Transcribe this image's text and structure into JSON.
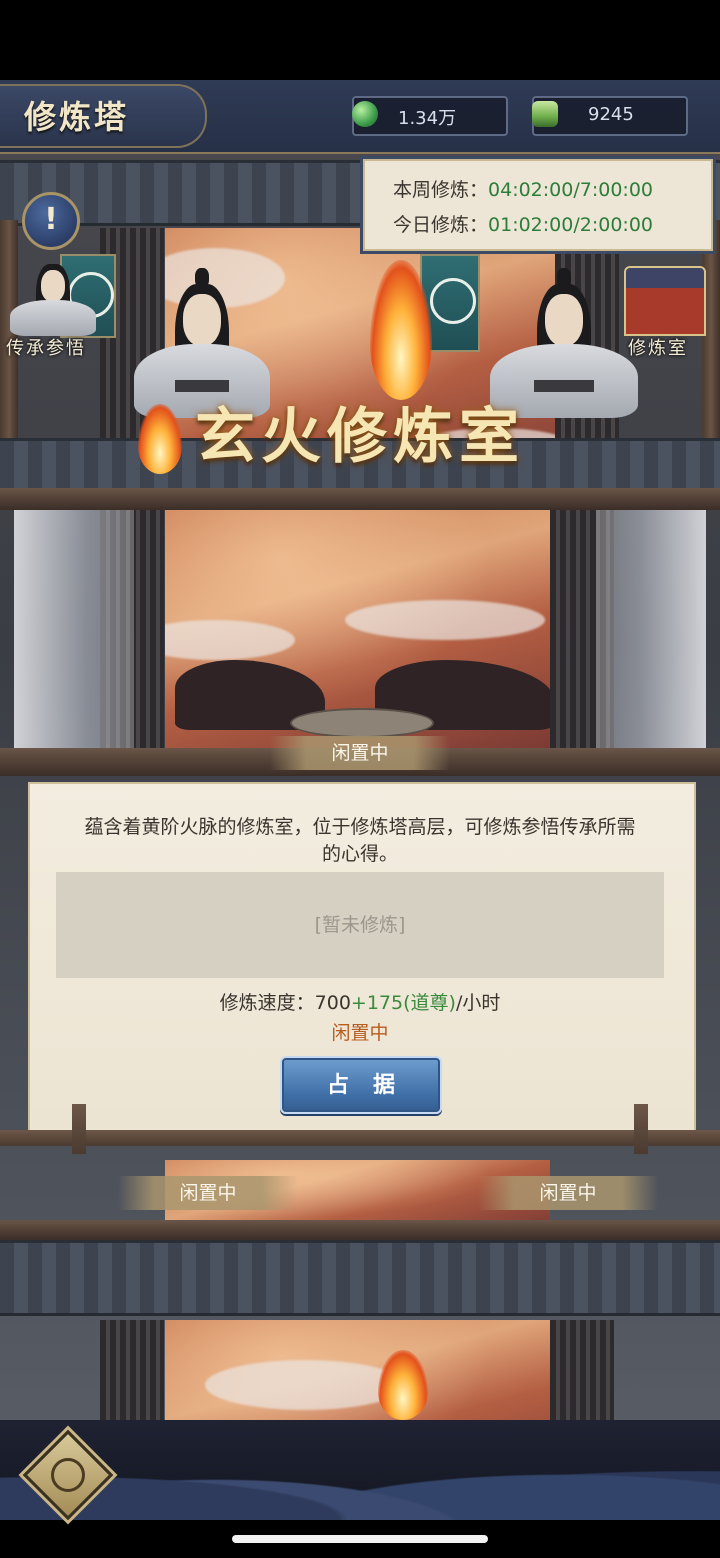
{
  "header": {
    "title": "修炼塔",
    "currency_primary": "1.34万",
    "currency_secondary": "9245"
  },
  "timers": {
    "weekly_label": "本周修炼：",
    "weekly_value": "04:02:00/7:00:00",
    "daily_label": "今日修炼：",
    "daily_value": "01:02:00/2:00:00"
  },
  "side_nav": {
    "left_label": "传承参悟",
    "right_label": "修炼室"
  },
  "room": {
    "name": "玄火修炼室"
  },
  "floor_status": {
    "upper": "闲置中",
    "lower_left": "闲置中",
    "lower_right": "闲置中"
  },
  "panel": {
    "description": "蕴含着黄阶火脉的修炼室，位于修炼塔高层，可修炼参悟传承所需的心得。",
    "empty_text": "[暂未修炼]",
    "speed_label": "修炼速度：",
    "speed_base": "700",
    "speed_bonus": "+175(道尊)",
    "speed_unit": "/小时",
    "status": "闲置中",
    "occupy_button": "占据"
  },
  "icons": {
    "jade": "jade-icon",
    "spirit_stone": "spirit-stone-icon",
    "info": "info-icon",
    "back": "back-icon"
  },
  "colors": {
    "header_bg": "#263047",
    "timer_green": "#2d7d3a",
    "status_orange": "#b85c1f",
    "button_blue": "#3f6ea6"
  }
}
